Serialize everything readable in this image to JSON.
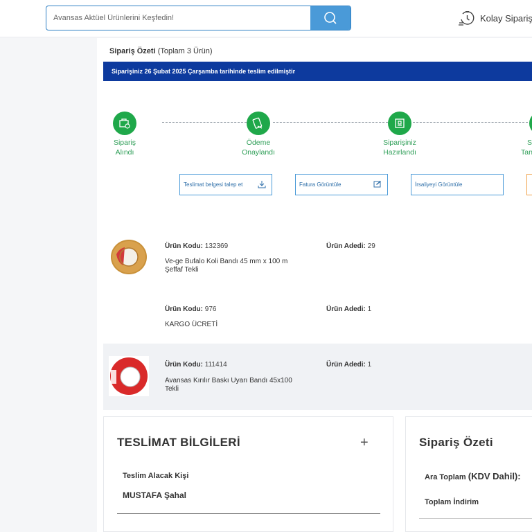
{
  "header": {
    "search_placeholder": "Avansas Aktüel Ürünlerini Keşfedin!",
    "kolay_label": "Kolay Sipariş"
  },
  "summary": {
    "title": "Sipariş Özeti",
    "count": "(Toplam 3 Ürün)",
    "banner": "Siparişiniz 26 Şubat 2025 Çarşamba tarihinde teslim edilmiştir"
  },
  "steps": [
    {
      "line1": "Sipariş",
      "line2": "Alındı"
    },
    {
      "line1": "Ödeme",
      "line2": "Onaylandı"
    },
    {
      "line1": "Siparişiniz",
      "line2": "Hazırlandı"
    },
    {
      "line1": "S",
      "line2": "Tan"
    }
  ],
  "actions": {
    "delivery_doc": "Teslimat belgesi talep et",
    "invoice": "Fatura Görüntüle",
    "waybill": "İrsaliyeyi Görüntüle"
  },
  "products": [
    {
      "code_label": "Ürün Kodu:",
      "code": "132369",
      "qty_label": "Ürün Adedi:",
      "qty": "29",
      "name": "Ve-ge Bufalo Koli Bandı 45 mm x 100 m Şeffaf Tekli"
    },
    {
      "code_label": "Ürün Kodu:",
      "code": "976",
      "qty_label": "Ürün Adedi:",
      "qty": "1",
      "name": "KARGO ÜCRETİ"
    },
    {
      "code_label": "Ürün Kodu:",
      "code": "111414",
      "qty_label": "Ürün Adedi:",
      "qty": "1",
      "name": "Avansas Kırılır Baskı Uyarı Bandı 45x100 Tekli"
    }
  ],
  "delivery": {
    "title": "TESLİMAT BİLGİLERİ",
    "plus": "+",
    "recipient_label": "Teslim Alacak Kişi",
    "recipient_name": "MUSTAFA Şahal"
  },
  "order_summary": {
    "title": "Sipariş Özeti",
    "subtotal_label": "Ara Toplam",
    "subtotal_suffix": "(KDV Dahil):",
    "discount_label": "Toplam İndirim"
  },
  "colors": {
    "brand_blue": "#0d3a9e",
    "accent_blue": "#4a9ad8",
    "step_green": "#1fa84a"
  }
}
